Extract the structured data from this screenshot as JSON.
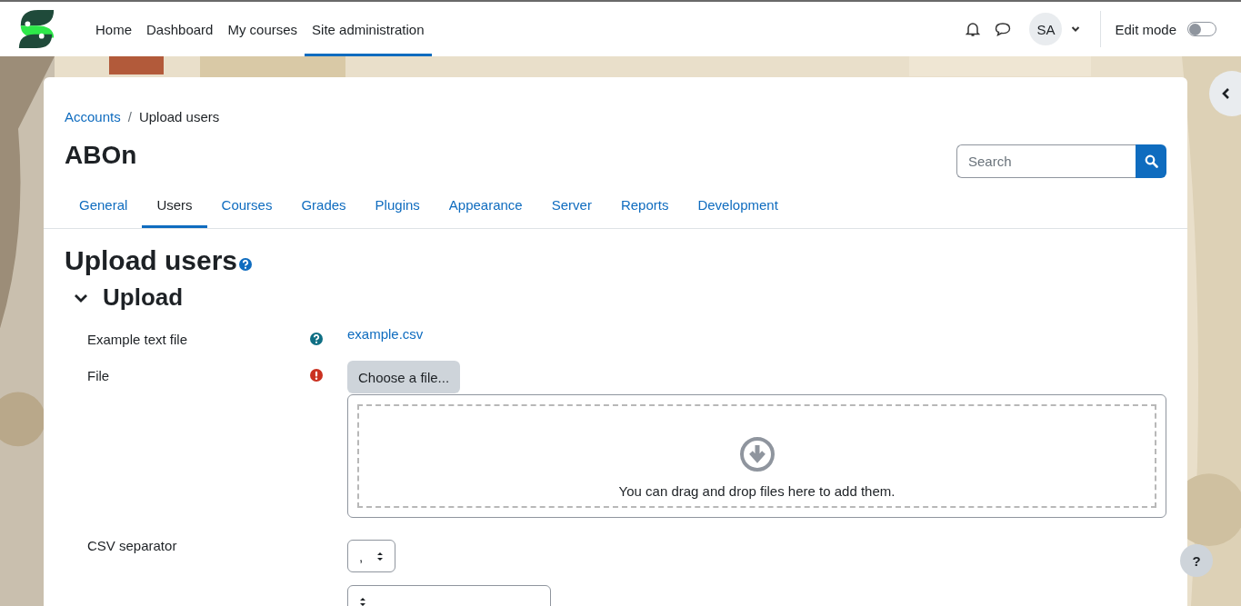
{
  "navbar": {
    "links": [
      {
        "label": "Home",
        "selected": false
      },
      {
        "label": "Dashboard",
        "selected": false
      },
      {
        "label": "My courses",
        "selected": false
      },
      {
        "label": "Site administration",
        "selected": true
      }
    ],
    "avatar": "SA",
    "edit_mode": {
      "label": "Edit mode",
      "on": false
    }
  },
  "breadcrumb": {
    "parent": "Accounts",
    "separator": "/",
    "current": "Upload users"
  },
  "site_title": "ABOn",
  "search": {
    "placeholder": "Search"
  },
  "tabs": [
    {
      "label": "General",
      "selected": false
    },
    {
      "label": "Users",
      "selected": true
    },
    {
      "label": "Courses",
      "selected": false
    },
    {
      "label": "Grades",
      "selected": false
    },
    {
      "label": "Plugins",
      "selected": false
    },
    {
      "label": "Appearance",
      "selected": false
    },
    {
      "label": "Server",
      "selected": false
    },
    {
      "label": "Reports",
      "selected": false
    },
    {
      "label": "Development",
      "selected": false
    }
  ],
  "page_heading": "Upload users",
  "section": {
    "title": "Upload",
    "expanded": true
  },
  "form_rows": [
    {
      "kind": "link",
      "label": "Example text file",
      "value": "example.csv"
    },
    {
      "kind": "file",
      "label": "File",
      "button": "Choose a file...",
      "drop_hint": "You can drag and drop files here to add them."
    },
    {
      "kind": "select",
      "label": "CSV separator",
      "value": ","
    },
    {
      "kind": "select"
    }
  ],
  "help_button": "?"
}
